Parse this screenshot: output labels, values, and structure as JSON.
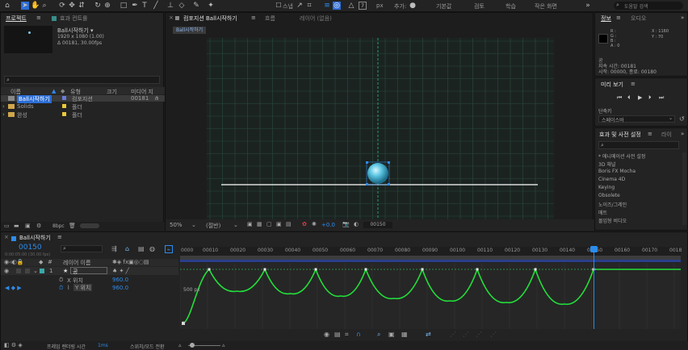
{
  "toolbar": {
    "align_label": "스냅",
    "search_placeholder": "도움말 검색",
    "workspace_tabs": [
      "추가:",
      "기본값",
      "검토",
      "학습",
      "작은 화면"
    ],
    "px_label": "px"
  },
  "project": {
    "tab_label": "프로젝트",
    "effects_tab": "효과 컨트롤",
    "comp_name": "Ball시작하기 ▾",
    "comp_info1": "1920 x 1080 (1.00)",
    "comp_info2": "Δ 00181, 30.00fps",
    "columns": [
      "이름",
      "유형",
      "크기",
      "미디어 지"
    ],
    "items": [
      {
        "name": "Ball시작하기",
        "type": "컴포지션",
        "size": "",
        "media": "00181",
        "color": "#6a7cd6"
      },
      {
        "name": "Solids",
        "type": "폴더",
        "size": "",
        "media": "",
        "color": "#e8c83a"
      },
      {
        "name": "완성",
        "type": "폴더",
        "size": "",
        "media": "",
        "color": "#e8c83a"
      }
    ],
    "bpc": "8bpc"
  },
  "comp": {
    "tab_label": "컴포지션 Ball시작하기",
    "layer_tab": "레이어 (없음)",
    "flow_tab": "흐름",
    "breadcrumb": "Ball시작하기",
    "zoom": "50%",
    "quality": "(절반)",
    "exposure": "+0.0",
    "timecode": "00150"
  },
  "info": {
    "tab_label": "정보",
    "audio_tab": "오디오",
    "r": "R :",
    "g": "G :",
    "b": "B :",
    "a": "A : 0",
    "x": "X : 1160",
    "y": "Y : 70",
    "label_line1": "공",
    "label_line2": "지속 시간: 00181",
    "label_line3": "시작: 00000, 종료: 00180"
  },
  "preview": {
    "tab_label": "미리 보기",
    "shortcut_label": "단축키",
    "shortcut_value": "스페이스바"
  },
  "effects": {
    "tab_label": "효과 및 사전 설정",
    "lib_tab": "라이",
    "items": [
      "* 애니메이션 사전 설정",
      "3D 채널",
      "Boris FX Mocha",
      "Cinema 4D",
      "Keying",
      "Obsolete",
      "노이즈/그레인",
      "매트",
      "몰입형 비디오"
    ]
  },
  "timeline": {
    "tab_label": "Ball시작하기",
    "timecode": "00150",
    "timecode_sub": "0:00:05:00 (30.00 fps)",
    "header_layer": "레이어 이름",
    "layer_num": "1",
    "layer_name": "공",
    "prop_x": "X 위치",
    "prop_x_val": "960.0",
    "prop_y": "Y 위치",
    "prop_y_val": "960.0",
    "graph_label": "500 px",
    "graph_zero": "0",
    "frame_label": "프레임 렌더링 시간",
    "frame_value": "1ms",
    "toggle_label": "스위치/모드 전환",
    "ruler": [
      "0000",
      "00010",
      "00020",
      "00030",
      "00040",
      "00050",
      "00060",
      "00070",
      "00080",
      "00090",
      "00100",
      "00110",
      "00120",
      "00130",
      "00140",
      "00150",
      "00160",
      "00170",
      "0018"
    ]
  },
  "colors": {
    "accent": "#2d8ceb",
    "curve": "#22e03a",
    "grid": "#2a4a3e"
  }
}
